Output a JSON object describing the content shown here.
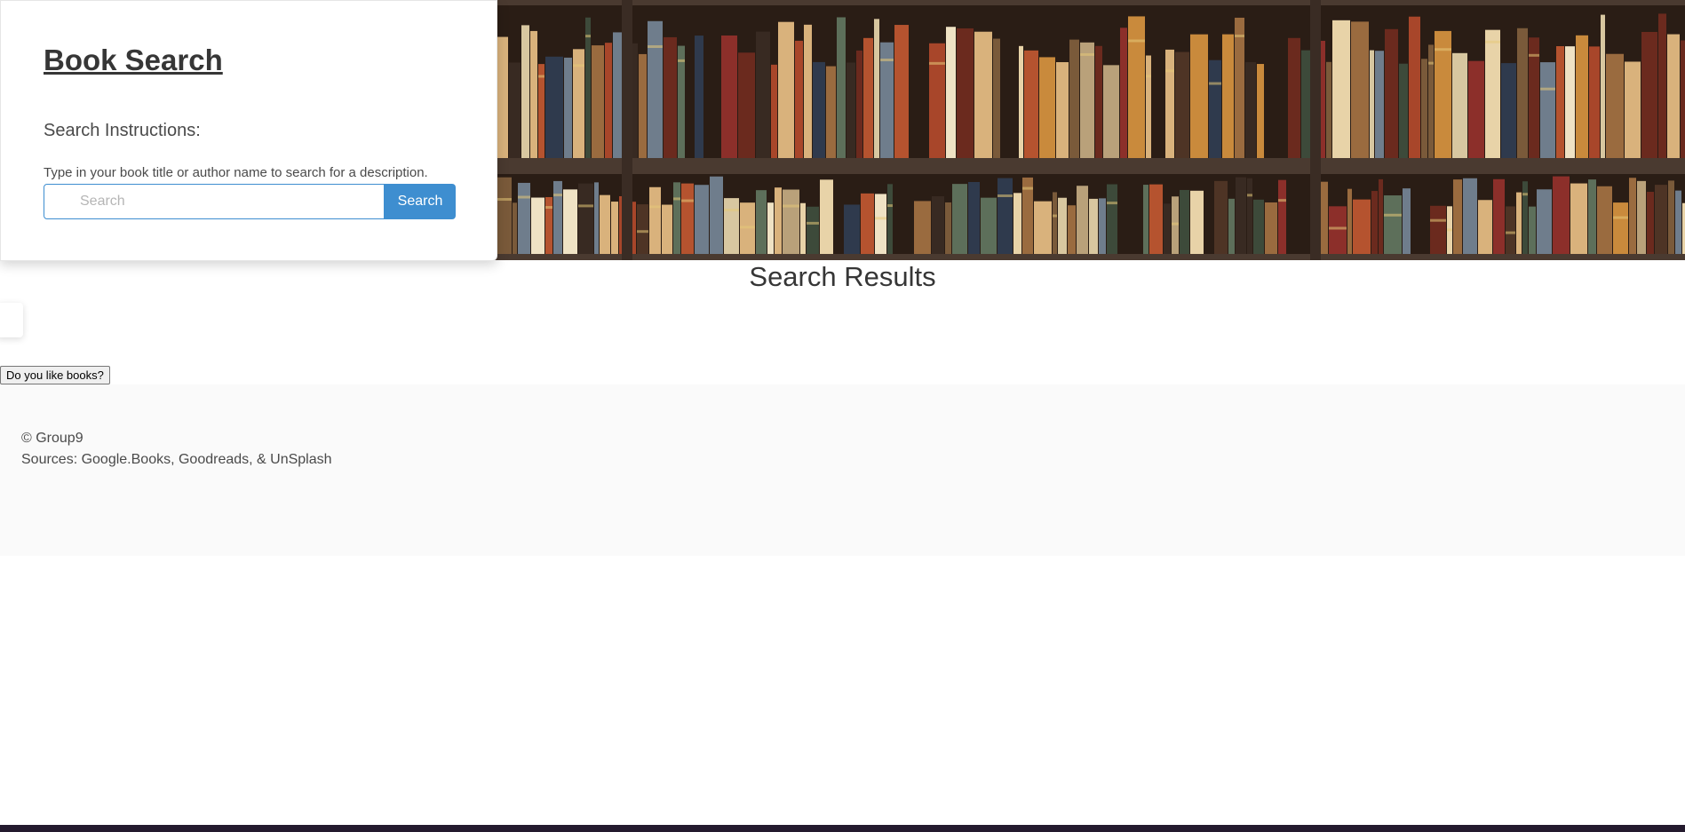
{
  "card": {
    "title": "Book Search",
    "instructions_heading": "Search Instructions:",
    "instructions_text": "Type in your book title or author name to search for a description.",
    "search_placeholder": "Search",
    "search_button": "Search"
  },
  "hero": {
    "image": "bookshelf-photo"
  },
  "results": {
    "heading": "Search Results"
  },
  "like_button": "Do you like books?",
  "footer": {
    "copyright": "© Group9",
    "sources": "Sources: Google.Books, Goodreads, & UnSplash"
  },
  "colors": {
    "accent": "#3e8ed0",
    "footer_bg": "#fafafa",
    "text": "#363636"
  }
}
